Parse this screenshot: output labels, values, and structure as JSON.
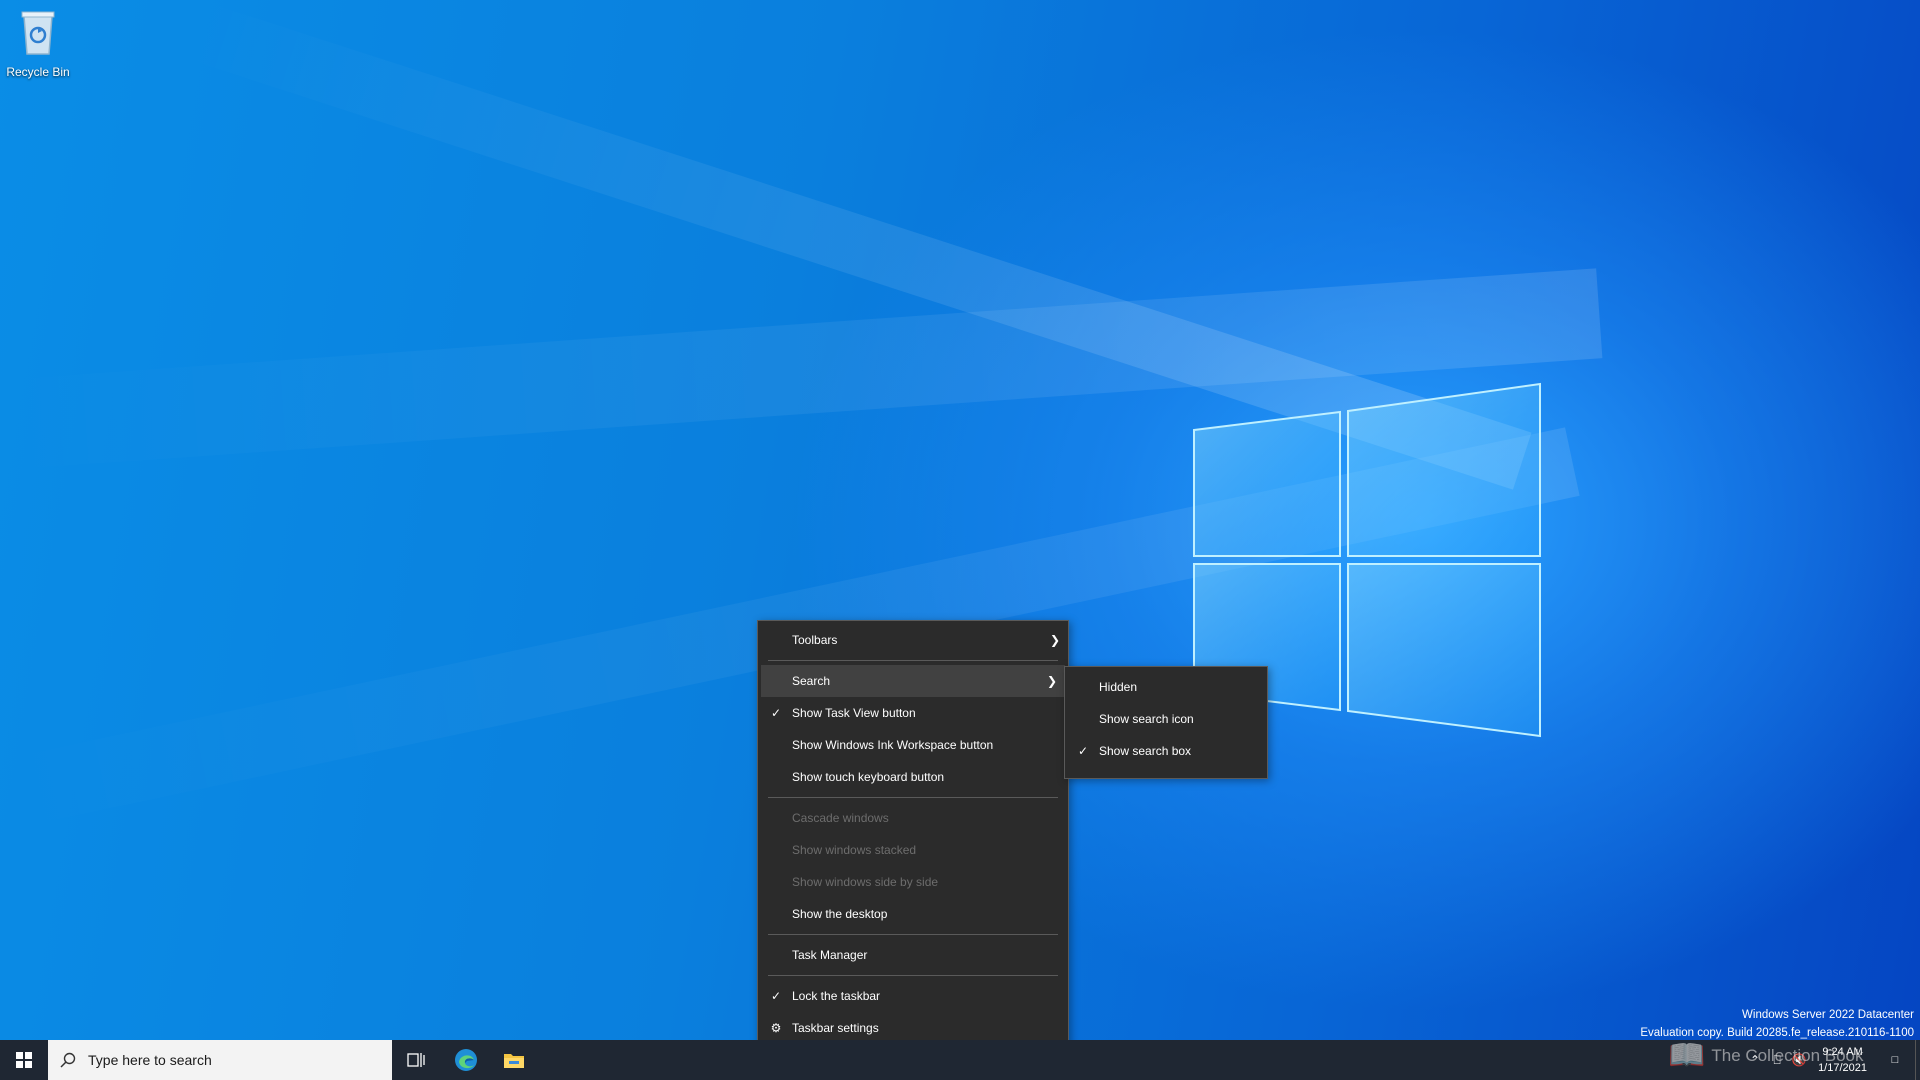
{
  "desktop": {
    "recycle_bin_label": "Recycle Bin"
  },
  "context_menu": {
    "items": [
      {
        "label": "Toolbars"
      },
      {
        "label": "Search"
      },
      {
        "label": "Show Task View button"
      },
      {
        "label": "Show Windows Ink Workspace button"
      },
      {
        "label": "Show touch keyboard button"
      },
      {
        "label": "Cascade windows"
      },
      {
        "label": "Show windows stacked"
      },
      {
        "label": "Show windows side by side"
      },
      {
        "label": "Show the desktop"
      },
      {
        "label": "Task Manager"
      },
      {
        "label": "Lock the taskbar"
      },
      {
        "label": "Taskbar settings"
      }
    ]
  },
  "search_submenu": {
    "items": [
      {
        "label": "Hidden"
      },
      {
        "label": "Show search icon"
      },
      {
        "label": "Show search box"
      }
    ]
  },
  "taskbar": {
    "search_placeholder": "Type here to search",
    "time": "9:24 AM",
    "date": "1/17/2021"
  },
  "watermark": {
    "line1": "Windows Server 2022 Datacenter",
    "line2": "Evaluation copy. Build 20285.fe_release.210116-1100"
  },
  "brand_text": "The Collection Book",
  "colors": {
    "menu_bg": "#2b2b2b",
    "menu_hover": "#414141",
    "taskbar_bg": "#1f2733",
    "disabled_text": "#6d6d6d"
  }
}
